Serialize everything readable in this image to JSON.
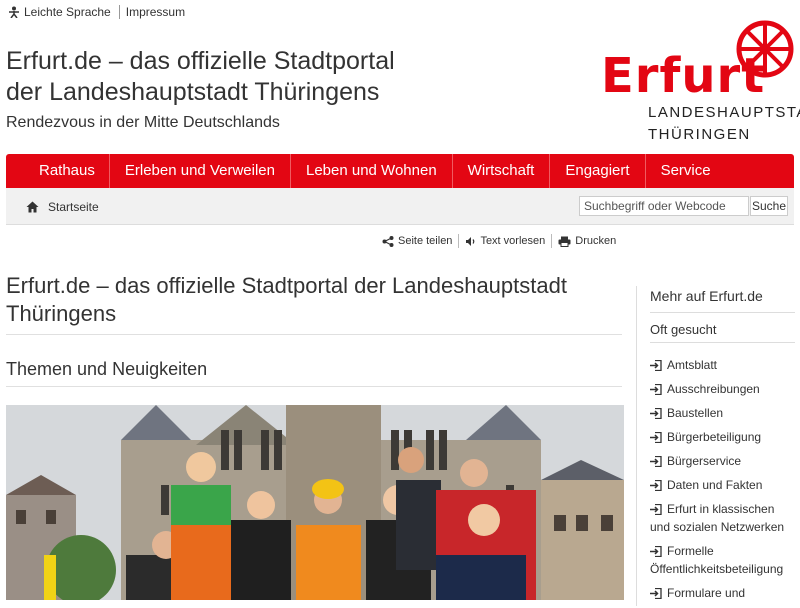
{
  "topbar": {
    "easy_language": "Leichte Sprache",
    "imprint": "Impressum"
  },
  "header": {
    "title_line1": "Erfurt.de – das offizielle Stadtportal",
    "title_line2": "der Landeshauptstadt Thüringens",
    "tagline": "Rendezvous in der Mitte Deutschlands"
  },
  "logo": {
    "word": "Erfurt",
    "line1": "LANDESHAUPTSTADT",
    "line2": "THÜRINGEN",
    "color": "#e30613"
  },
  "nav": {
    "items": [
      "Rathaus",
      "Erleben und Verweilen",
      "Leben und Wohnen",
      "Wirtschaft",
      "Engagiert",
      "Service"
    ]
  },
  "breadcrumb": {
    "home": "Startseite"
  },
  "search": {
    "placeholder": "Suchbegriff oder Webcode",
    "button": "Suche"
  },
  "tools": {
    "share": "Seite teilen",
    "read_aloud": "Text vorlesen",
    "print": "Drucken"
  },
  "main": {
    "h1_line1": "Erfurt.de – das offizielle Stadtportal der Landeshauptstadt",
    "h1_line2": "Thüringens",
    "section_title": "Themen und Neuigkeiten"
  },
  "aside": {
    "title": "Mehr auf Erfurt.de",
    "subtitle": "Oft gesucht",
    "links": [
      "Amtsblatt",
      "Ausschreibungen",
      "Baustellen",
      "Bürgerbeteiligung",
      "Bürgerservice",
      "Daten und Fakten",
      "Erfurt in klassischen und sozialen Netzwerken",
      "Formelle Öffentlichkeitsbeteiligung",
      "Formulare und"
    ]
  },
  "colors": {
    "brand_red": "#e30613"
  }
}
